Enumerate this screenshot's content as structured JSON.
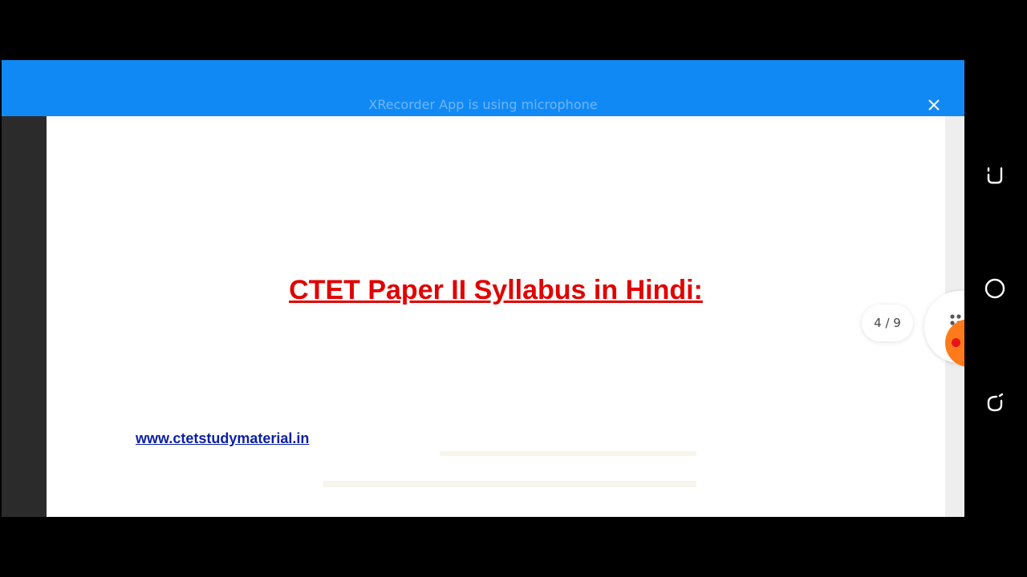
{
  "banner": {
    "text": "XRecorder App is using microphone"
  },
  "document": {
    "title": "CTET Paper II Syllabus in Hindi:",
    "link_text": "www.ctetstudymaterial.in"
  },
  "pager": {
    "label": "4 / 9"
  },
  "recorder": {
    "accent_color": "#ff7a1a",
    "record_dot_color": "#e8141b"
  },
  "navbar": {
    "buttons": [
      "back-icon",
      "home-icon",
      "recents-icon"
    ]
  },
  "colors": {
    "banner_bg": "#1189f5",
    "title": "#e00000",
    "link": "#0a1fa6"
  }
}
